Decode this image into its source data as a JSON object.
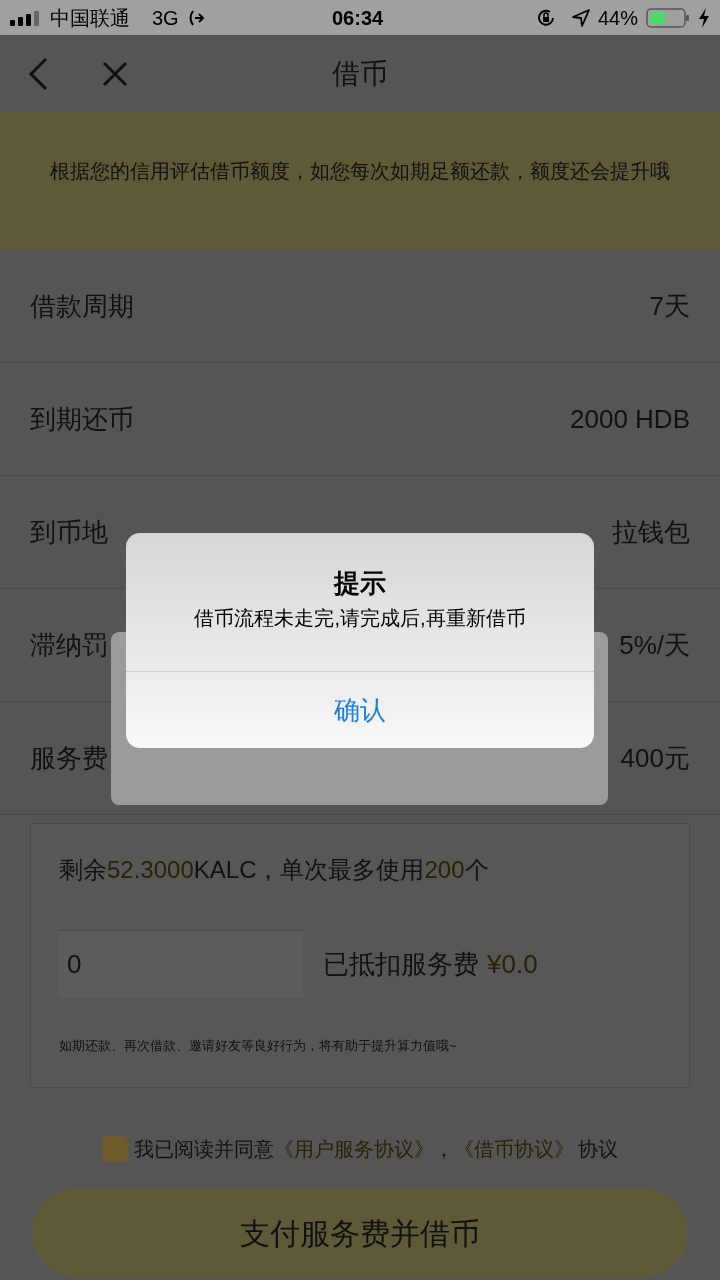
{
  "status_bar": {
    "carrier": "中国联通",
    "network": "3G",
    "time": "06:34",
    "battery": "44%"
  },
  "nav": {
    "title": "借币"
  },
  "header": {
    "description": "根据您的信用评估借币额度，如您每次如期足额还款，额度还会提升哦"
  },
  "rows": [
    {
      "label": "借款周期",
      "value": "7天"
    },
    {
      "label": "到期还币",
      "value": "2000 HDB"
    },
    {
      "label": "到币地",
      "value": "拉钱包"
    },
    {
      "label": "滞纳罚",
      "value": "5%/天"
    },
    {
      "label": "服务费",
      "value": "400元"
    }
  ],
  "deduction": {
    "summary": [
      {
        "text": "剩余",
        "highlight": false
      },
      {
        "text": "52.3000",
        "highlight": true
      },
      {
        "text": "KALC，单次最多使用",
        "highlight": false
      },
      {
        "text": "200",
        "highlight": true
      },
      {
        "text": "个",
        "highlight": false
      }
    ],
    "input_value": "0",
    "deducted_label": "已抵扣服务费",
    "deducted_amount": "¥0.0",
    "note": "如期还款、再次借款、邀请好友等良好行为，将有助于提升算力值哦~"
  },
  "agreement": {
    "checked": true,
    "text": "我已阅读并同意",
    "links": [
      "《用户服务协议》",
      "《借币协议》"
    ],
    "separator": "，",
    "suffix": "协议"
  },
  "submit": {
    "label": "支付服务费并借币"
  },
  "alert": {
    "title": "提示",
    "message": "借币流程未走完,请完成后,再重新借币",
    "button": "确认"
  }
}
